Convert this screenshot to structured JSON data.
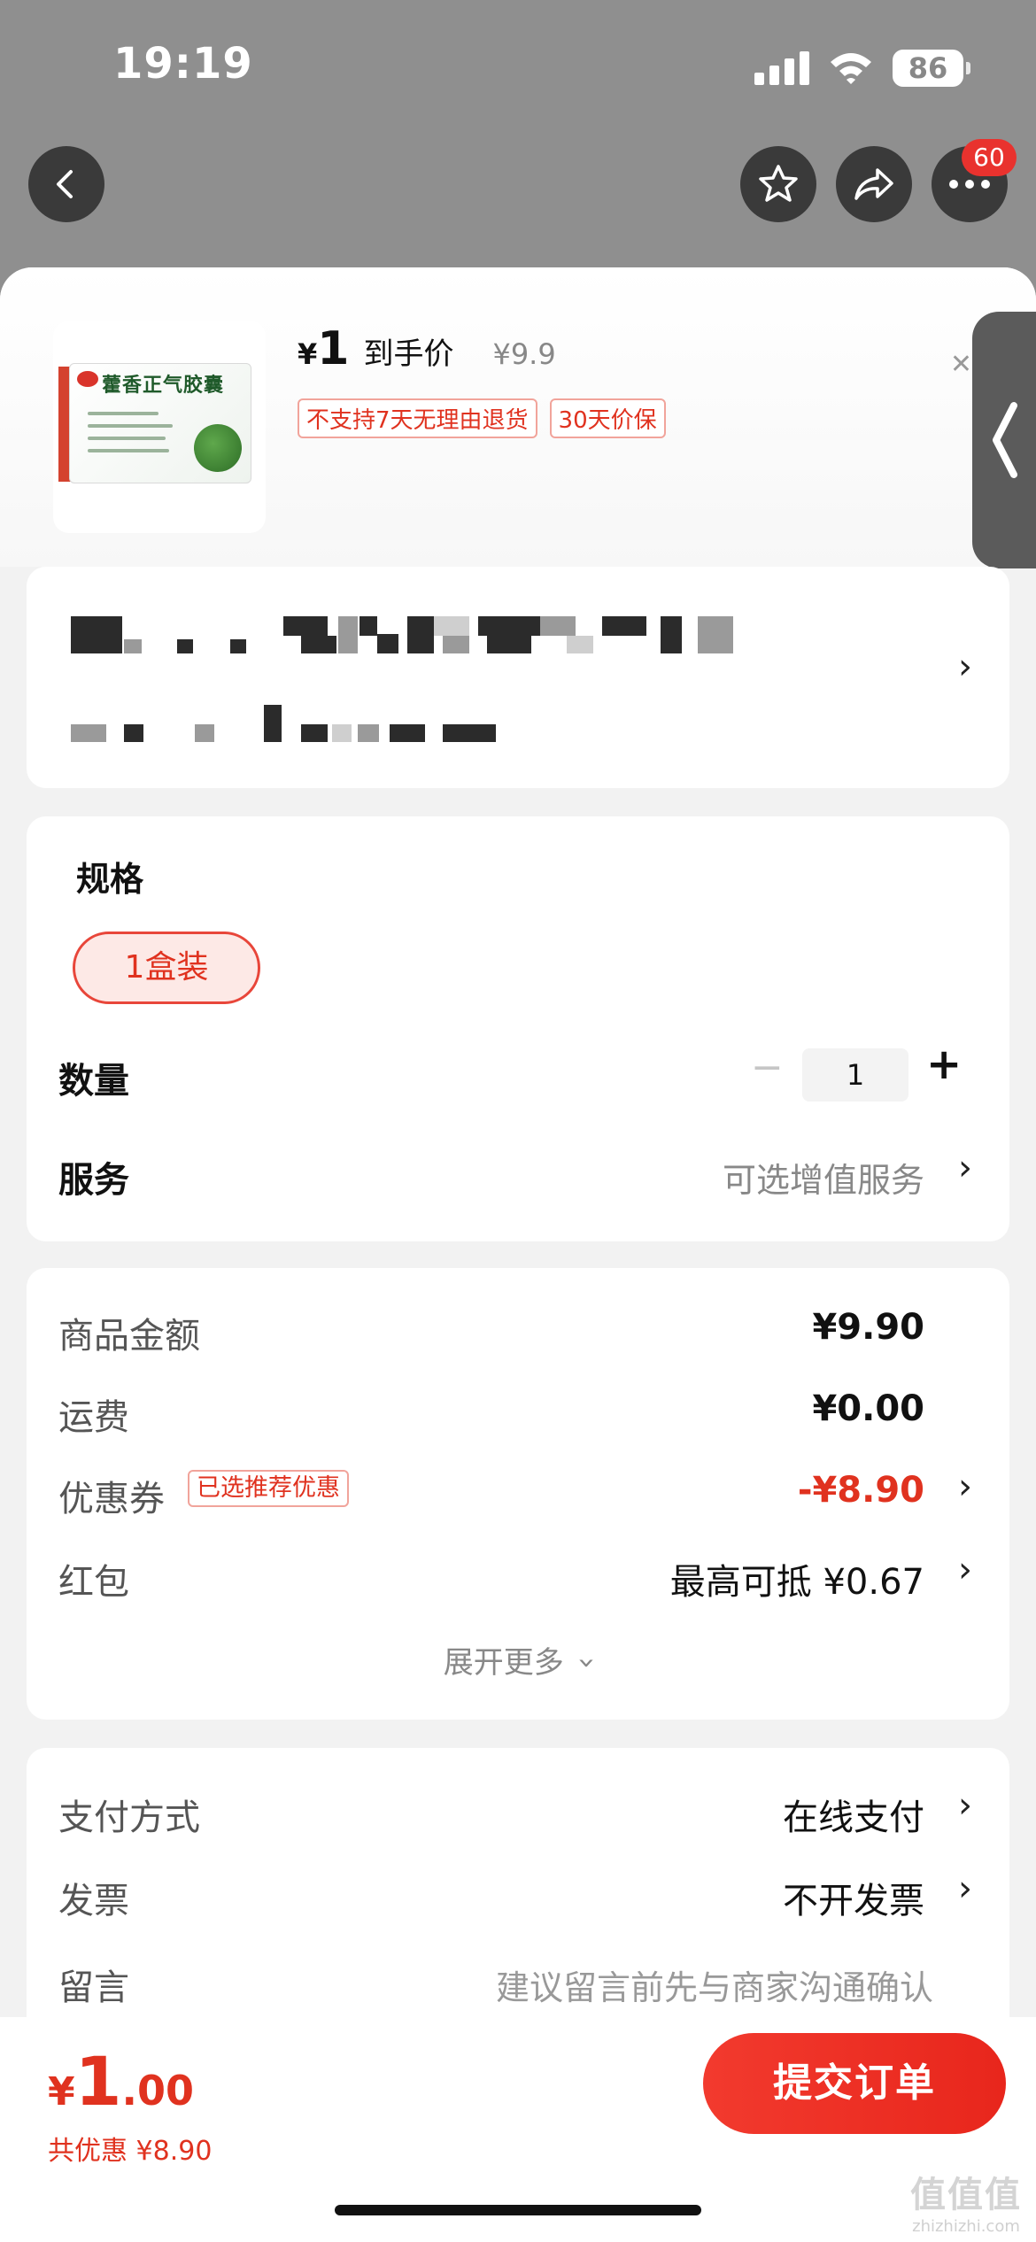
{
  "status_bar": {
    "time": "19:19",
    "battery": "86"
  },
  "nav": {
    "more_badge": "60"
  },
  "product": {
    "box_title": "藿香正气胶囊",
    "price_yen": "¥",
    "price_value": "1",
    "price_label": "到手价",
    "original_price": "¥9.9",
    "tags": [
      "不支持7天无理由退货",
      "30天价保"
    ]
  },
  "spec": {
    "title": "规格",
    "selected": "1盒装",
    "quantity_label": "数量",
    "quantity_value": "1",
    "minus": "−",
    "plus": "+",
    "service_label": "服务",
    "service_value": "可选增值服务"
  },
  "amounts": {
    "goods_label": "商品金额",
    "goods_value": "¥9.90",
    "shipping_label": "运费",
    "shipping_value": "¥0.00",
    "coupon_label": "优惠券",
    "coupon_tag": "已选推荐优惠",
    "coupon_value": "-¥8.90",
    "redpacket_label": "红包",
    "redpacket_value": "最高可抵 ¥0.67",
    "expand": "展开更多"
  },
  "payment": {
    "method_label": "支付方式",
    "method_value": "在线支付",
    "invoice_label": "发票",
    "invoice_value": "不开发票",
    "note_label": "留言",
    "note_value": "建议留言前先与商家沟通确认"
  },
  "bottom": {
    "total_yen": "¥",
    "total_int": "1",
    "total_dec": ".00",
    "discount": "共优惠 ¥8.90",
    "submit": "提交订单"
  },
  "watermark": {
    "logo": "值值值",
    "url": "zhizhizhi.com"
  },
  "colors": {
    "accent": "#e0321f",
    "button": "#f23a2e"
  },
  "icons": [
    "back-icon",
    "star-icon",
    "share-icon",
    "more-icon",
    "chevron-right-icon",
    "chevron-down-icon",
    "wifi-icon",
    "signal-icon",
    "battery-icon"
  ]
}
